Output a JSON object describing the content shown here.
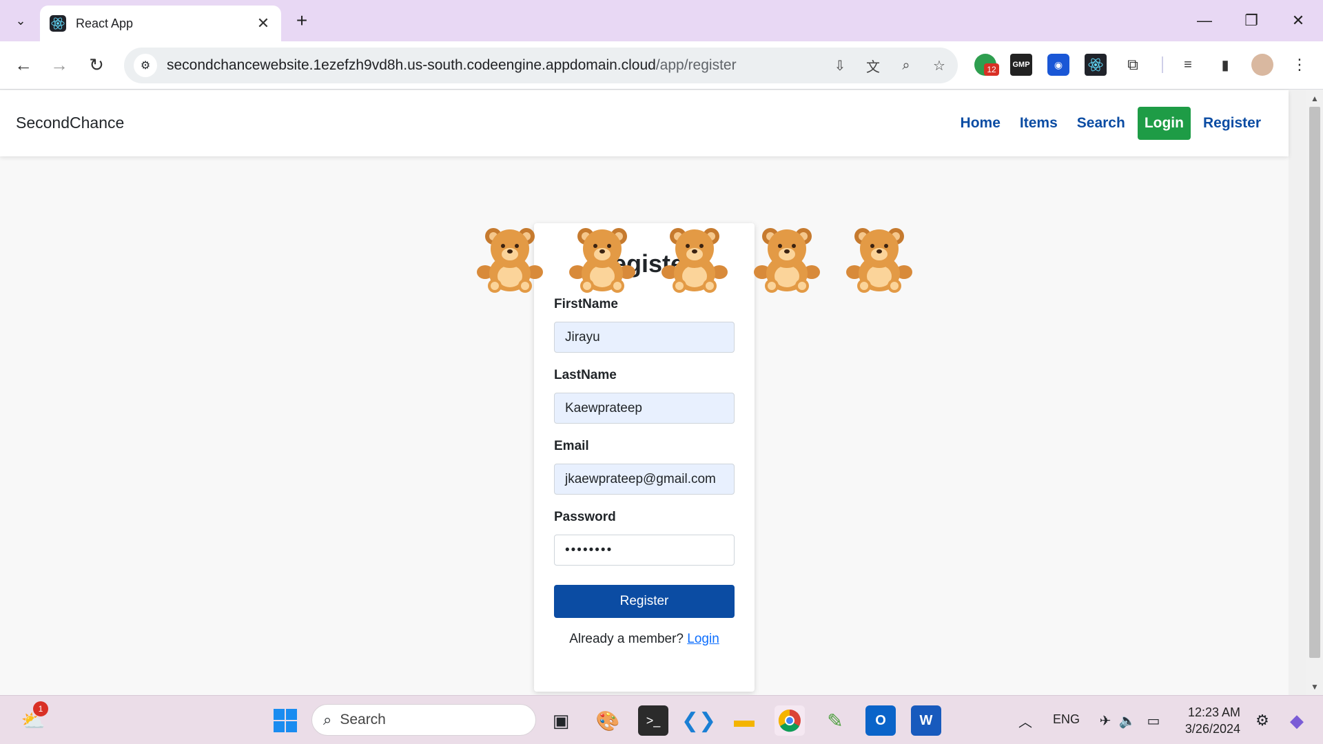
{
  "browser": {
    "tab_title": "React App",
    "url_host": "secondchancewebsite.1ezefzh9vd8h.us-south.codeengine.appdomain.cloud",
    "url_path": "/app/register",
    "extension_badge": "12",
    "gmp_label": "GMP"
  },
  "navbar": {
    "brand": "SecondChance",
    "links": {
      "home": "Home",
      "items": "Items",
      "search": "Search",
      "login": "Login",
      "register": "Register"
    }
  },
  "form": {
    "title": "Register",
    "firstname_label": "FirstName",
    "firstname_value": "Jirayu",
    "lastname_label": "LastName",
    "lastname_value": "Kaewprateep",
    "email_label": "Email",
    "email_value": "jkaewprateep@gmail.com",
    "password_label": "Password",
    "password_value": "••••••••",
    "submit_label": "Register",
    "member_text": "Already a member?",
    "login_link": "Login"
  },
  "taskbar": {
    "search_placeholder": "Search",
    "weather_badge": "1",
    "language": "ENG",
    "time": "12:23 AM",
    "date": "3/26/2024"
  },
  "colors": {
    "brand_blue": "#0b4ca3",
    "login_green": "#1e9c46",
    "autofill": "#e8f0fe"
  }
}
